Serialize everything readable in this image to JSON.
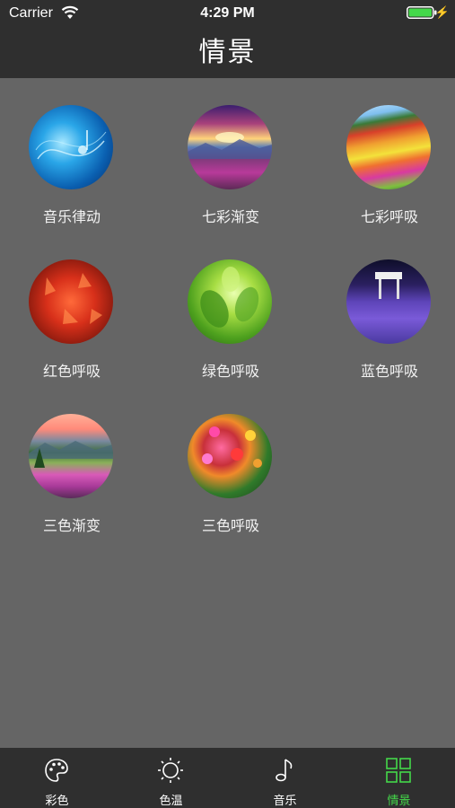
{
  "status": {
    "carrier": "Carrier",
    "time": "4:29 PM"
  },
  "header": {
    "title": "情景"
  },
  "scenes": [
    {
      "label": "音乐律动",
      "icon": "music-rhythm-image"
    },
    {
      "label": "七彩渐变",
      "icon": "rainbow-gradient-image"
    },
    {
      "label": "七彩呼吸",
      "icon": "rainbow-breathing-image"
    },
    {
      "label": "红色呼吸",
      "icon": "red-breathing-image"
    },
    {
      "label": "绿色呼吸",
      "icon": "green-breathing-image"
    },
    {
      "label": "蓝色呼吸",
      "icon": "blue-breathing-image"
    },
    {
      "label": "三色渐变",
      "icon": "tricolor-gradient-image"
    },
    {
      "label": "三色呼吸",
      "icon": "tricolor-breathing-image"
    }
  ],
  "tabs": [
    {
      "label": "彩色",
      "icon": "palette-icon",
      "active": false
    },
    {
      "label": "色温",
      "icon": "sun-icon",
      "active": false
    },
    {
      "label": "音乐",
      "icon": "music-note-icon",
      "active": false
    },
    {
      "label": "情景",
      "icon": "grid-icon",
      "active": true
    }
  ],
  "colors": {
    "accent": "#44d84a",
    "bar": "#2f2f2f",
    "background": "#656565"
  }
}
